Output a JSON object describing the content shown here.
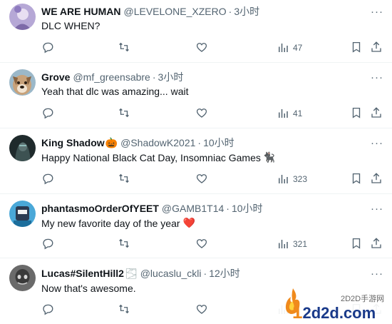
{
  "replies": [
    {
      "name": "WE ARE HUMAN",
      "name_emoji": "",
      "handle": "@LEVELONE_XZERO",
      "dot": "·",
      "time": "3小时",
      "text": "DLC WHEN?",
      "text_emoji": "",
      "views": "47",
      "avatar_color": "#b6a8d6"
    },
    {
      "name": "Grove",
      "name_emoji": "",
      "handle": "@mf_greensabre",
      "dot": "·",
      "time": "3小时",
      "text": "Yeah that dlc was amazing... wait",
      "text_emoji": "",
      "views": "41",
      "avatar_color": "#c8a27a"
    },
    {
      "name": "King Shadow",
      "name_emoji": "🎃",
      "handle": "@ShadowK2021",
      "dot": "·",
      "time": "10小时",
      "text": "Happy National Black Cat Day, Insomniac Games",
      "text_emoji": "🐈‍⬛",
      "views": "323",
      "avatar_color": "#2e3a3a"
    },
    {
      "name": "phantasmoOrderOfYEET",
      "name_emoji": "",
      "handle": "@GAMB1T14",
      "dot": "·",
      "time": "10小时",
      "text": "My new favorite day of the year",
      "text_emoji": "❤️",
      "views": "321",
      "avatar_color": "#4aa8d8"
    },
    {
      "name": "Lucas#SilentHill2",
      "name_emoji": "🌫",
      "handle": "@lucaslu_ckli",
      "dot": "·",
      "time": "12小时",
      "text": "Now that's awesome.",
      "text_emoji": "",
      "views": "",
      "avatar_color": "#555555"
    }
  ],
  "icons": {
    "reply": "reply-icon",
    "retweet": "retweet-icon",
    "like": "like-icon",
    "views": "views-icon",
    "bookmark": "bookmark-icon",
    "share": "share-icon",
    "more": "more-icon"
  },
  "more_glyph": "···",
  "watermark": {
    "small": "2D2D手游网",
    "big": "2d2d.com"
  },
  "colors": {
    "text": "#0f1419",
    "secondary": "#536471",
    "divider": "#eff3f4",
    "heart": "#e0245e"
  }
}
